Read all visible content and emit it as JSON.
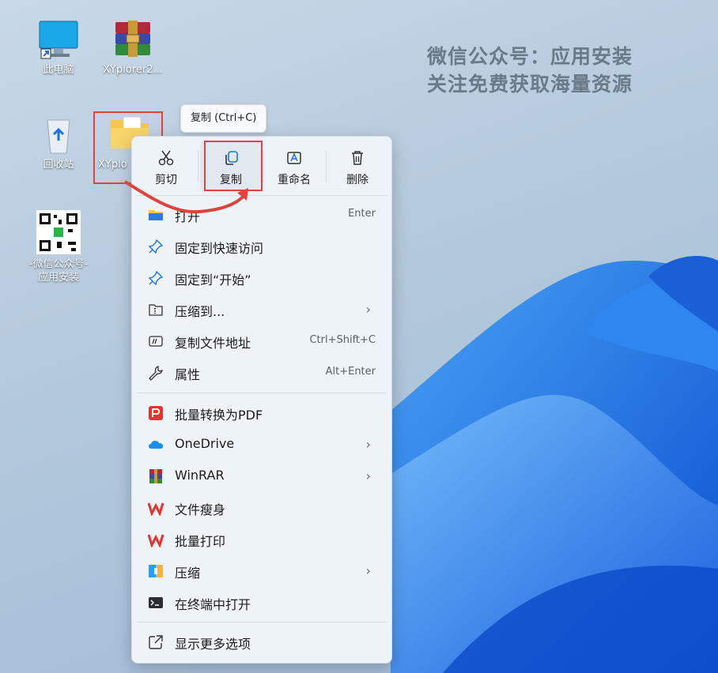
{
  "desktop": {
    "icons": [
      {
        "label": "此电脑"
      },
      {
        "label": "XYplorer2..."
      },
      {
        "label": "回收站"
      },
      {
        "label": "XYplo"
      },
      {
        "label_line1": "-微信公众号-",
        "label_line2": "应用安装"
      }
    ],
    "watermark": {
      "line1": "微信公众号：应用安装",
      "line2": "关注免费获取海量资源"
    }
  },
  "tooltip": {
    "text": "复制 (Ctrl+C)"
  },
  "context_menu": {
    "top_actions": [
      {
        "label": "剪切",
        "icon": "scissors-icon"
      },
      {
        "label": "复制",
        "icon": "copy-icon"
      },
      {
        "label": "重命名",
        "icon": "rename-icon"
      },
      {
        "label": "删除",
        "icon": "trash-icon"
      }
    ],
    "items": [
      {
        "label": "打开",
        "shortcut": "Enter",
        "icon": "folder-icon"
      },
      {
        "label": "固定到快速访问",
        "icon": "pin-icon"
      },
      {
        "label": "固定到“开始”",
        "icon": "pin-icon"
      },
      {
        "label": "压缩到...",
        "has_submenu": true,
        "icon": "zip-icon"
      },
      {
        "label": "复制文件地址",
        "shortcut": "Ctrl+Shift+C",
        "icon": "path-icon"
      },
      {
        "label": "属性",
        "shortcut": "Alt+Enter",
        "icon": "wrench-icon"
      },
      {
        "label": "批量转换为PDF",
        "icon": "pdf-icon"
      },
      {
        "label": "OneDrive",
        "has_submenu": true,
        "icon": "cloud-icon"
      },
      {
        "label": "WinRAR",
        "has_submenu": true,
        "icon": "winrar-icon"
      },
      {
        "label": "文件瘦身",
        "icon": "wps-icon"
      },
      {
        "label": "批量打印",
        "icon": "wps-icon"
      },
      {
        "label": "压缩",
        "has_submenu": true,
        "icon": "compress-icon"
      },
      {
        "label": "在终端中打开",
        "icon": "terminal-icon"
      },
      {
        "label": "显示更多选项",
        "icon": "more-options-icon"
      }
    ],
    "chevron": "›"
  },
  "colors": {
    "highlight_red": "#e0433c",
    "accent_blue": "#1a73e8"
  }
}
